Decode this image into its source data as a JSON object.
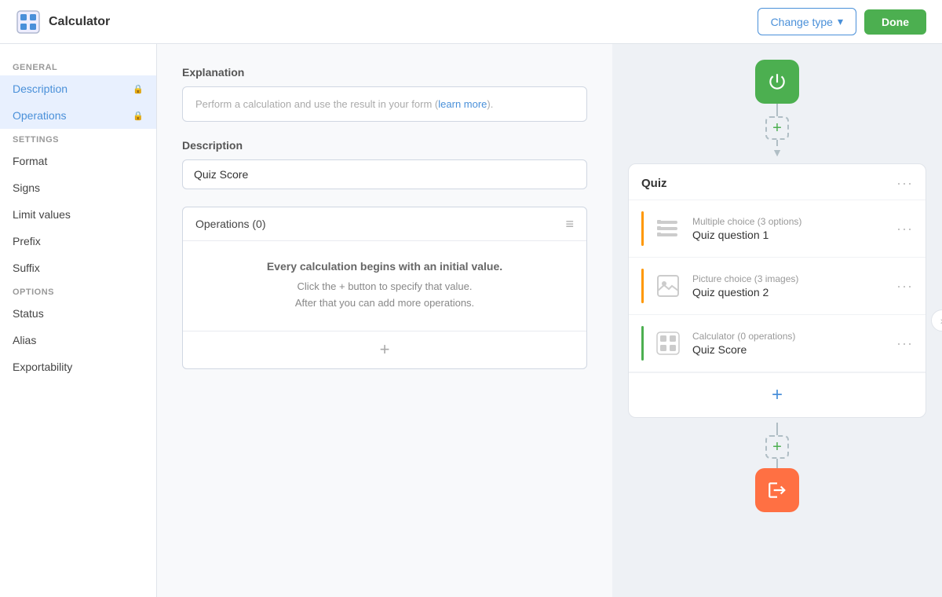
{
  "header": {
    "logo_icon": "⊞",
    "title": "Calculator",
    "change_type_label": "Change type",
    "done_label": "Done"
  },
  "sidebar": {
    "general_label": "General",
    "description_label": "Description",
    "operations_label": "Operations",
    "settings_label": "Settings",
    "format_label": "Format",
    "signs_label": "Signs",
    "limit_values_label": "Limit values",
    "prefix_label": "Prefix",
    "suffix_label": "Suffix",
    "options_label": "Options",
    "status_label": "Status",
    "alias_label": "Alias",
    "exportability_label": "Exportability"
  },
  "main": {
    "explanation_section": "Explanation",
    "explanation_placeholder": "Perform a calculation and use the result in your form (",
    "explanation_link": "learn more",
    "explanation_suffix": ").",
    "description_section": "Description",
    "description_value": "Quiz Score",
    "operations_title": "Operations (0)",
    "operations_bold": "Every calculation begins with an initial value.",
    "operations_line1": "Click the + button to specify that value.",
    "operations_line2": "After that you can add more operations."
  },
  "quiz_panel": {
    "quiz_title": "Quiz",
    "items": [
      {
        "type": "Multiple choice (3 options)",
        "name": "Quiz question 1",
        "bar_color": "#ff9800"
      },
      {
        "type": "Picture choice (3 images)",
        "name": "Quiz question 2",
        "bar_color": "#ff9800"
      },
      {
        "type": "Calculator (0 operations)",
        "name": "Quiz Score",
        "bar_color": "#4caf50"
      }
    ]
  }
}
